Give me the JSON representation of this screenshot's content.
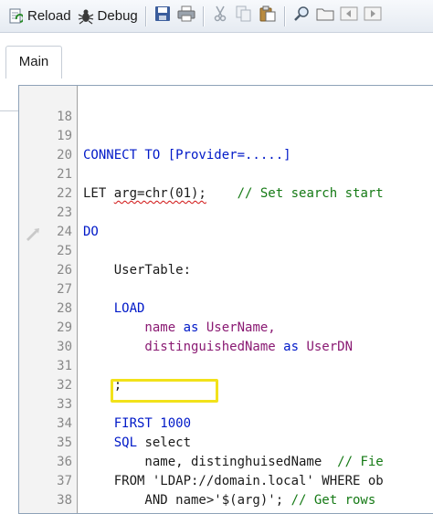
{
  "toolbar": {
    "reload_label": "Reload",
    "debug_label": "Debug",
    "icons": [
      "reload-icon",
      "debug-icon",
      "save-icon",
      "print-icon",
      "cut-icon",
      "copy-icon",
      "paste-icon",
      "find-icon",
      "folder-icon",
      "back-icon",
      "forward-icon"
    ]
  },
  "tabs": [
    {
      "label": "Main",
      "active": true
    }
  ],
  "editor": {
    "lines": [
      {
        "num": "18",
        "code": ""
      },
      {
        "num": "19",
        "code": "CONNECT TO [Provider=.....]"
      },
      {
        "num": "20",
        "code": ""
      },
      {
        "num": "21",
        "code_a": "LET ",
        "code_b": "arg=chr(01);",
        "code_c": "    ",
        "comment": "// Set search start"
      },
      {
        "num": "22",
        "code": ""
      },
      {
        "num": "23",
        "code": "DO"
      },
      {
        "num": "24",
        "code": ""
      },
      {
        "num": "25",
        "code": "    UserTable:"
      },
      {
        "num": "26",
        "code": ""
      },
      {
        "num": "27",
        "code": "    LOAD"
      },
      {
        "num": "28",
        "code_a": "        name ",
        "code_b": "as",
        "code_c": " UserName,"
      },
      {
        "num": "29",
        "code_a": "        distinguishedName ",
        "code_b": "as",
        "code_c": " UserDN"
      },
      {
        "num": "30",
        "code": ""
      },
      {
        "num": "31",
        "code": "    ;"
      },
      {
        "num": "32",
        "code": ""
      },
      {
        "num": "33",
        "code": "    FIRST 1000"
      },
      {
        "num": "34",
        "code_a": "    SQL",
        "code_b": " select"
      },
      {
        "num": "35",
        "code_a": "        name, distinghuisedName  ",
        "comment": "// Fie"
      },
      {
        "num": "36",
        "code": "    FROM 'LDAP://domain.local' WHERE ob"
      },
      {
        "num": "37",
        "code_a": "        AND name>'$(arg)'; ",
        "comment": "// Get rows"
      },
      {
        "num": "38",
        "code": ""
      }
    ]
  },
  "colors": {
    "keyword": "#0019c8",
    "comment": "#157a15",
    "field": "#8a1a73",
    "highlight": "#f2e21a",
    "squiggle": "#d01010"
  }
}
